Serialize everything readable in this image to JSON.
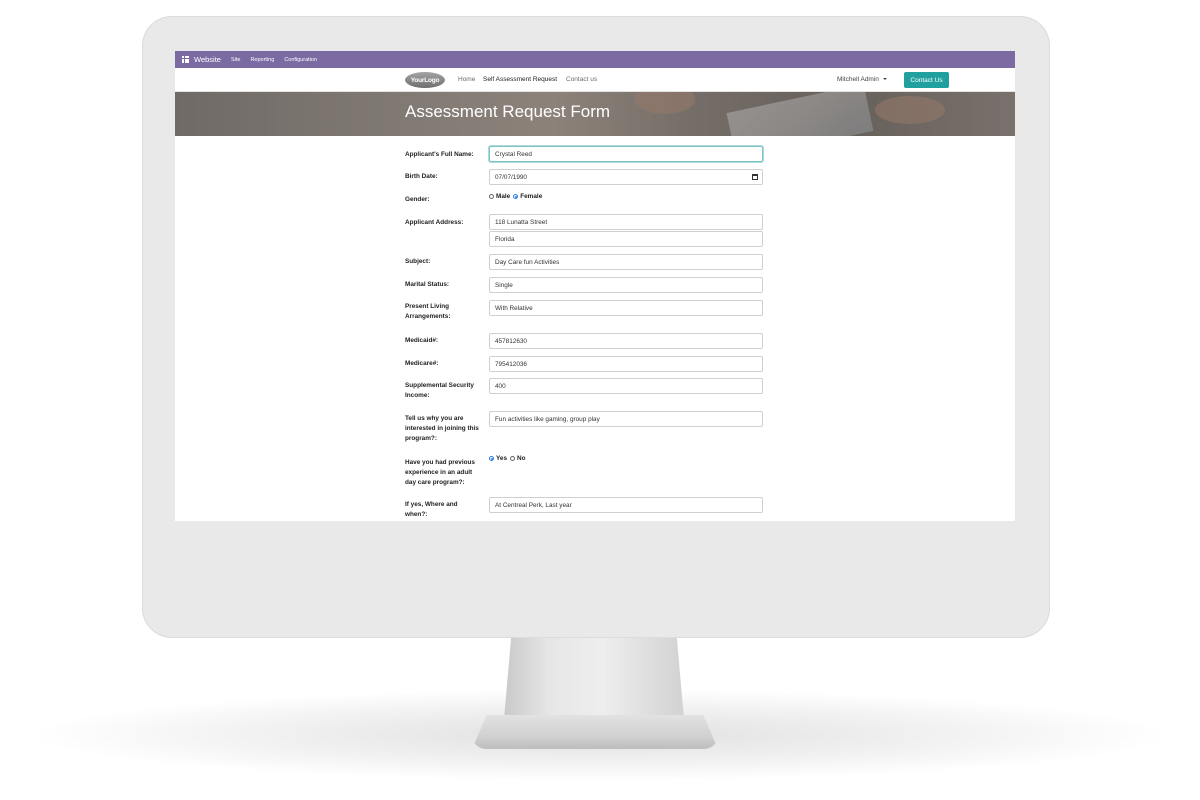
{
  "admin_bar": {
    "brand": "Website",
    "menu": [
      "Site",
      "Reporting",
      "Configuration"
    ],
    "color": "#7c6ba3"
  },
  "site_nav": {
    "logo": "YourLogo",
    "links": [
      "Home",
      "Self Assessment Request",
      "Contact us"
    ],
    "active_link": "Self Assessment Request",
    "user": "Mitchell Admin",
    "cta": "Contact Us",
    "cta_color": "#21a0a0"
  },
  "hero": {
    "title": "Assessment Request Form"
  },
  "form": {
    "full_name": {
      "label": "Applicant's Full Name:",
      "value": "Crystal Reed"
    },
    "birth_date": {
      "label": "Birth Date:",
      "value": "07/07/1990"
    },
    "gender": {
      "label": "Gender:",
      "options": [
        "Male",
        "Female"
      ],
      "selected": "Female"
    },
    "address": {
      "label": "Applicant Address:",
      "line1": "118 Lunatta Street",
      "line2": "Florida"
    },
    "subject": {
      "label": "Subject:",
      "value": "Day Care fun Activities"
    },
    "marital_status": {
      "label": "Marital Status:",
      "value": "Single"
    },
    "living": {
      "label": "Present Living Arrangements:",
      "value": "With Relative"
    },
    "medicaid": {
      "label": "Medicaid#:",
      "value": "457812630"
    },
    "medicare": {
      "label": "Medicare#:",
      "value": "795412036"
    },
    "ssi": {
      "label": "Supplemental Security Income:",
      "value": "400"
    },
    "interest": {
      "label": "Tell us why you are interested in joining this program?:",
      "value": "Fun activities like gaming, group play"
    },
    "previous": {
      "label": "Have you had previous experience in an adult day care program?:",
      "options": [
        "Yes",
        "No"
      ],
      "selected": "Yes"
    },
    "where_when": {
      "label": "If yes, Where and when?:",
      "value": "At Centreal Perk, Last year"
    }
  }
}
